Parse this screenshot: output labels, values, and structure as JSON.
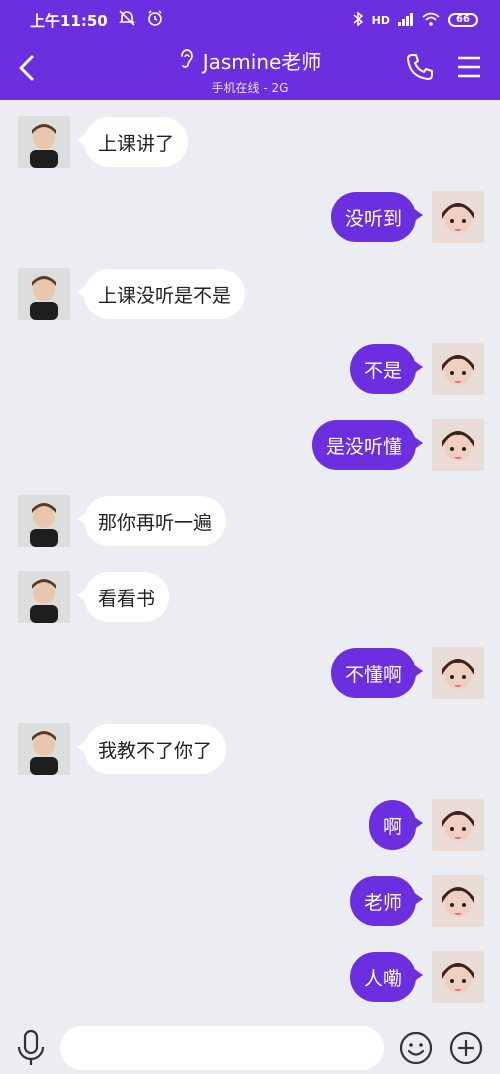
{
  "status_bar": {
    "time": "上午11:50",
    "network": "HD",
    "battery": "66"
  },
  "chat_header": {
    "title": "Jasmine老师",
    "subtitle": "手机在线 - 2G"
  },
  "messages": [
    {
      "side": "in",
      "text": "上课讲了"
    },
    {
      "side": "out",
      "text": "没听到"
    },
    {
      "side": "in",
      "text": "上课没听是不是"
    },
    {
      "side": "out",
      "text": "不是"
    },
    {
      "side": "out",
      "text": "是没听懂"
    },
    {
      "side": "in",
      "text": "那你再听一遍"
    },
    {
      "side": "in",
      "text": "看看书"
    },
    {
      "side": "out",
      "text": "不懂啊"
    },
    {
      "side": "in",
      "text": "我教不了你了"
    },
    {
      "side": "out",
      "text": "啊"
    },
    {
      "side": "out",
      "text": "老师"
    },
    {
      "side": "out",
      "text": "人嘞"
    }
  ],
  "input": {
    "value": "",
    "placeholder": ""
  },
  "colors": {
    "accent": "#6b2fe0",
    "background": "#ecedf3",
    "incoming_bubble": "#ffffff"
  },
  "icons": {
    "back": "chevron-left-icon",
    "ear": "ear-icon",
    "phone": "phone-icon",
    "menu": "hamburger-menu-icon",
    "mic": "microphone-icon",
    "emoji": "smiley-face-icon",
    "add": "plus-circle-icon"
  }
}
